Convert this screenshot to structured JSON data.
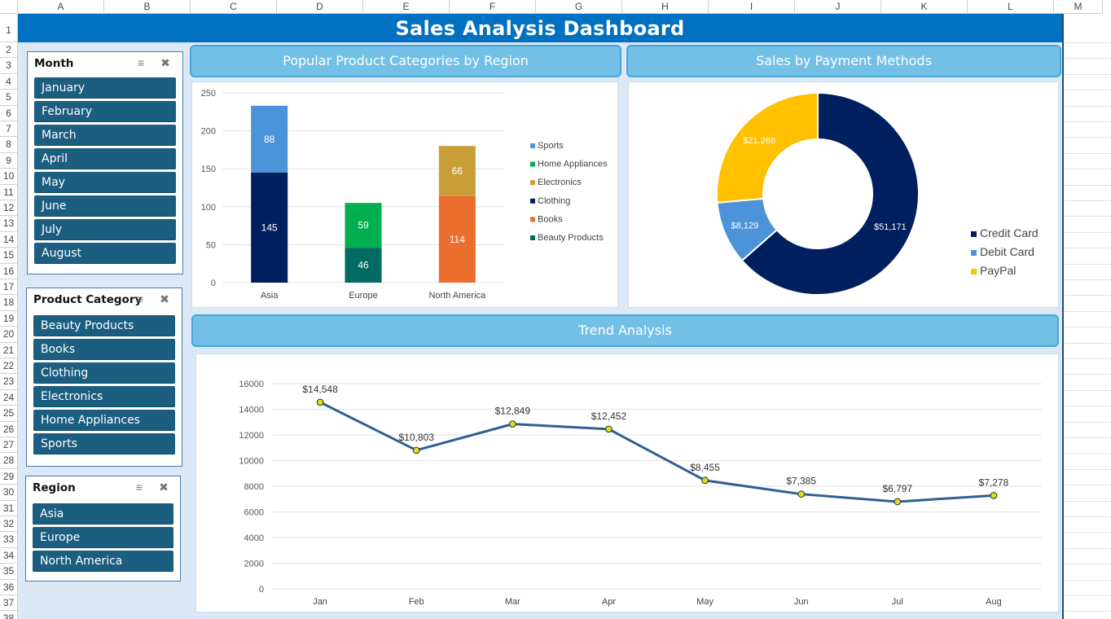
{
  "sheet": {
    "columns": [
      "A",
      "B",
      "C",
      "D",
      "E",
      "F",
      "G",
      "H",
      "I",
      "J",
      "K",
      "L",
      "M"
    ],
    "rows": [
      "1",
      "2",
      "3",
      "4",
      "5",
      "6",
      "7",
      "8",
      "9",
      "10",
      "11",
      "12",
      "13",
      "14",
      "15",
      "16",
      "17",
      "18",
      "19",
      "20",
      "21",
      "22",
      "23",
      "24",
      "25",
      "26",
      "27",
      "28",
      "29",
      "30",
      "31",
      "32",
      "33",
      "34",
      "35",
      "36",
      "37",
      "38"
    ]
  },
  "dashboard": {
    "title": "Sales Analysis Dashboard"
  },
  "slicers": {
    "month": {
      "title": "Month",
      "items": [
        "January",
        "February",
        "March",
        "April",
        "May",
        "June",
        "July",
        "August"
      ]
    },
    "category": {
      "title": "Product Category",
      "items": [
        "Beauty Products",
        "Books",
        "Clothing",
        "Electronics",
        "Home Appliances",
        "Sports"
      ]
    },
    "region": {
      "title": "Region",
      "items": [
        "Asia",
        "Europe",
        "North America"
      ]
    }
  },
  "panels": {
    "categories_title": "Popular Product Categories by Region",
    "payment_title": "Sales by Payment Methods",
    "trend_title": "Trend Analysis"
  },
  "chart_data": [
    {
      "type": "bar",
      "stacked": true,
      "categories": [
        "Asia",
        "Europe",
        "North America"
      ],
      "series": [
        {
          "name": "Beauty Products",
          "values": [
            0,
            46,
            0
          ],
          "color": "#006b62"
        },
        {
          "name": "Books",
          "values": [
            0,
            0,
            114
          ],
          "color": "#eb6e2e"
        },
        {
          "name": "Clothing",
          "values": [
            145,
            0,
            0
          ],
          "color": "#001f5f"
        },
        {
          "name": "Electronics",
          "values": [
            0,
            0,
            66
          ],
          "color": "#c99e37"
        },
        {
          "name": "Home Appliances",
          "values": [
            0,
            59,
            0
          ],
          "color": "#00b050"
        },
        {
          "name": "Sports",
          "values": [
            88,
            0,
            0
          ],
          "color": "#4d93d9"
        }
      ],
      "legend_order": [
        "Sports",
        "Home Appliances",
        "Electronics",
        "Clothing",
        "Books",
        "Beauty Products"
      ],
      "ylim": [
        0,
        250
      ],
      "yticks": [
        "0",
        "50",
        "100",
        "150",
        "200",
        "250"
      ],
      "legend": "right",
      "grid": true
    },
    {
      "type": "pie",
      "donut": true,
      "labels": [
        "Credit Card",
        "Debit Card",
        "PayPal"
      ],
      "values": [
        51171,
        8129,
        21268
      ],
      "value_labels": [
        "$51,171",
        "$8,129",
        "$21,268"
      ],
      "colors": [
        "#001f5f",
        "#4d93d9",
        "#ffc000"
      ],
      "legend": "right"
    },
    {
      "type": "line",
      "x": [
        "Jan",
        "Feb",
        "Mar",
        "Apr",
        "May",
        "Jun",
        "Jul",
        "Aug"
      ],
      "values": [
        14548,
        10803,
        12849,
        12452,
        8455,
        7385,
        6797,
        7278
      ],
      "value_labels": [
        "$14,548",
        "$10,803",
        "$12,849",
        "$12,452",
        "$8,455",
        "$7,385",
        "$6,797",
        "$7,278"
      ],
      "ylim": [
        0,
        16000
      ],
      "yticks": [
        "0",
        "2000",
        "4000",
        "6000",
        "8000",
        "10000",
        "12000",
        "14000",
        "16000"
      ],
      "line_color": "#2f5f96",
      "marker_color": "#e6dc1e",
      "grid": true
    }
  ]
}
